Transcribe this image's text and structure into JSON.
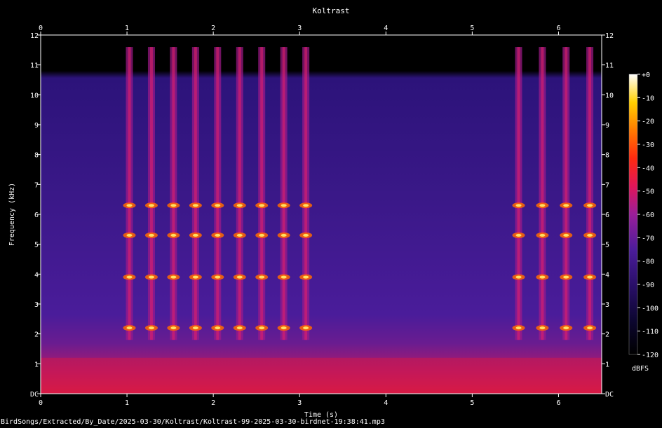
{
  "title": "Koltrast",
  "footer": "BirdSongs/Extracted/By_Date/2025-03-30/Koltrast/Koltrast-99-2025-03-30-birdnet-19:38:41.mp3",
  "chart_data": {
    "type": "heatmap",
    "title": "Koltrast",
    "xlabel": "Time (s)",
    "ylabel": "Frequency (kHz)",
    "xlim": [
      0,
      6.5
    ],
    "ylim": [
      0,
      12
    ],
    "x_ticks": [
      "0",
      "1",
      "2",
      "3",
      "4",
      "5",
      "6"
    ],
    "y_ticks": [
      "DC",
      "1",
      "2",
      "3",
      "4",
      "5",
      "6",
      "7",
      "8",
      "9",
      "10",
      "11",
      "12"
    ],
    "colorbar": {
      "label": "dBFS",
      "range": [
        -120,
        0
      ],
      "ticks": [
        "+0",
        "-10",
        "-20",
        "-30",
        "-40",
        "-50",
        "-60",
        "-70",
        "-80",
        "-90",
        "-100",
        "-110",
        "-120"
      ]
    },
    "song_segments_s": [
      [
        0.9,
        3.2
      ],
      [
        5.4,
        6.5
      ]
    ],
    "harmonic_bands_khz": [
      2.2,
      3.9,
      5.3,
      6.3
    ]
  }
}
